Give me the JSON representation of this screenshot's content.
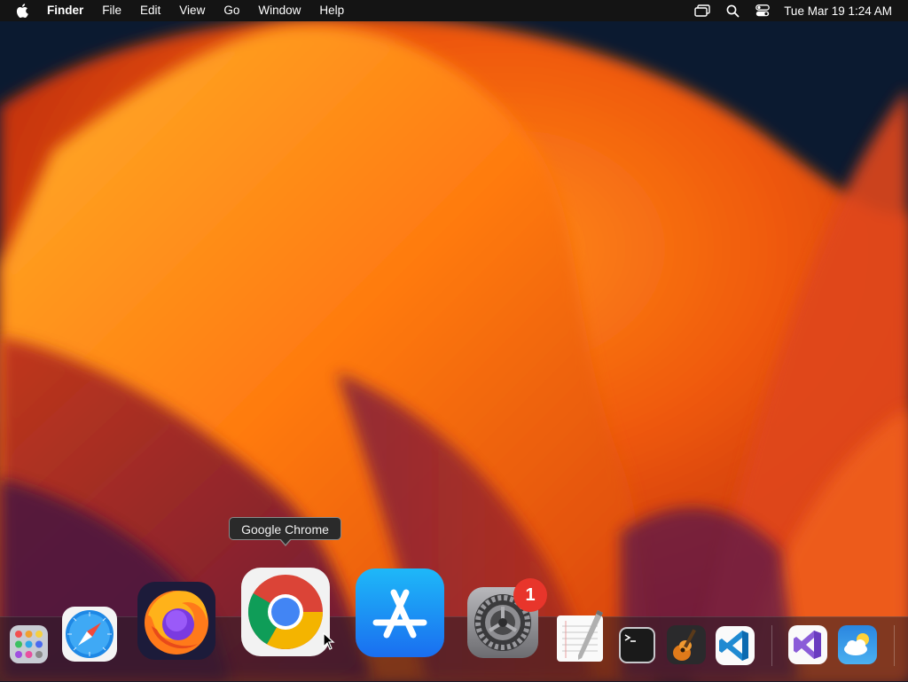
{
  "menubar": {
    "apple_icon": "apple-logo-icon",
    "app_name": "Finder",
    "menus": [
      "File",
      "Edit",
      "View",
      "Go",
      "Window",
      "Help"
    ],
    "status_icons": [
      "screen-mirroring-icon",
      "spotlight-search-icon",
      "control-center-icon"
    ],
    "clock": "Tue Mar 19  1:24 AM"
  },
  "dock": {
    "tooltip": "Google Chrome",
    "settings_badge": "1",
    "apps": [
      {
        "name": "Launchpad",
        "icon": "launchpad-icon"
      },
      {
        "name": "Safari",
        "icon": "safari-icon"
      },
      {
        "name": "Firefox",
        "icon": "firefox-icon"
      },
      {
        "name": "Google Chrome",
        "icon": "chrome-icon"
      },
      {
        "name": "App Store",
        "icon": "app-store-icon"
      },
      {
        "name": "System Settings",
        "icon": "system-settings-icon"
      },
      {
        "name": "TextEdit",
        "icon": "textedit-icon"
      },
      {
        "name": "Terminal",
        "icon": "terminal-icon"
      },
      {
        "name": "GarageBand",
        "icon": "garageband-icon"
      },
      {
        "name": "Visual Studio Code",
        "icon": "vscode-icon"
      },
      {
        "name": "Visual Studio",
        "icon": "visual-studio-icon"
      },
      {
        "name": "Weather",
        "icon": "weather-icon"
      }
    ]
  },
  "colors": {
    "wallpaper_primary": "#f06a10",
    "wallpaper_dark": "#0a1628",
    "badge": "#e8352b"
  }
}
